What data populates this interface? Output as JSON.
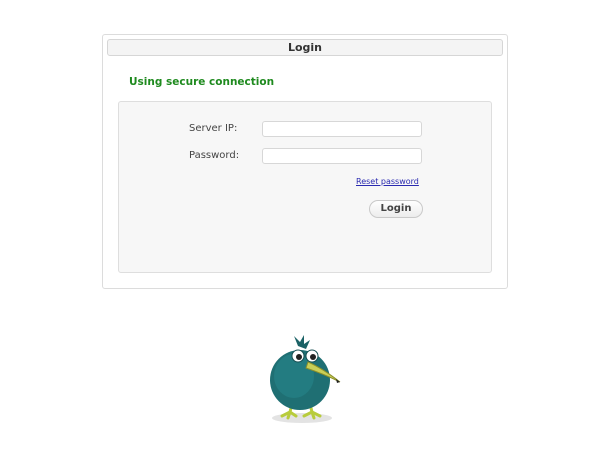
{
  "header": {
    "title": "Login"
  },
  "status": {
    "secure_text": "Using secure connection"
  },
  "form": {
    "server_ip_label": "Server IP:",
    "server_ip_value": "",
    "password_label": "Password:",
    "password_value": "",
    "reset_link": "Reset password",
    "login_button": "Login"
  },
  "colors": {
    "secure_green": "#1e8a1e",
    "link_blue": "#2a2ab0",
    "mascot_teal": "#1f6f73"
  },
  "mascot": {
    "icon": "kiwi-bird-mascot"
  }
}
